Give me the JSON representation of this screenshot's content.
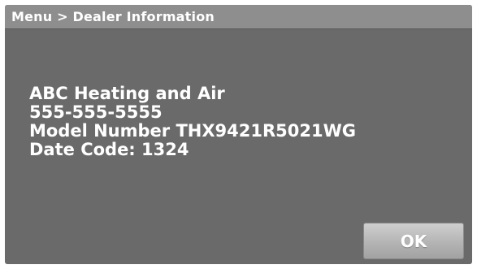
{
  "header": {
    "breadcrumb": "Menu > Dealer Information"
  },
  "dealer_info": {
    "company_name": "ABC Heating and Air",
    "phone": "555-555-5555",
    "model_number": "Model Number THX9421R5021WG",
    "date_code": "Date Code: 1324"
  },
  "actions": {
    "ok_label": "OK"
  },
  "colors": {
    "screen_background": "#6a6a6a",
    "header_background": "#8e8e8e",
    "text": "#ffffff"
  }
}
